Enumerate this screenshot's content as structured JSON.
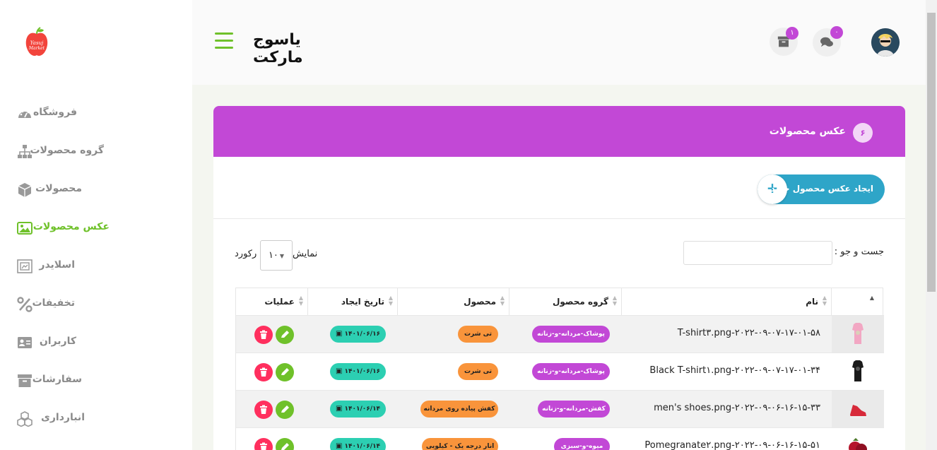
{
  "app": {
    "title": "یاسوج مارکت",
    "logo_text": "Yasuj Market"
  },
  "header": {
    "messages_badge": "۰",
    "archive_badge": "۱"
  },
  "sidebar": {
    "items": [
      {
        "label": "فروشگاه",
        "icon": "dashboard-icon"
      },
      {
        "label": "گروه محصولات",
        "icon": "sitemap-icon"
      },
      {
        "label": "محصولات",
        "icon": "cube-icon"
      },
      {
        "label": "عکس محصولات",
        "icon": "image-icon",
        "active": true
      },
      {
        "label": "اسلایدر",
        "icon": "slider-icon"
      },
      {
        "label": "تخفیفات",
        "icon": "percent-icon"
      },
      {
        "label": "کاربران",
        "icon": "id-card-icon"
      },
      {
        "label": "سفارشات",
        "icon": "archive-icon"
      },
      {
        "label": "انبارداری",
        "icon": "boxes-icon"
      }
    ]
  },
  "card": {
    "number": "۶",
    "title": "عکس محصولات",
    "create_label": "ایجاد عکس محصول جدید",
    "create_icon": "+"
  },
  "controls": {
    "search_label": "جست و جو :",
    "show_label": "نمایش",
    "page_size": "۱۰",
    "records_label": "رکورد"
  },
  "table": {
    "headers": {
      "name": "نام",
      "group": "گروه محصول",
      "product": "محصول",
      "date": "تاریخ ایجاد",
      "ops": "عملیات"
    },
    "rows": [
      {
        "file": "T-shirt۳.png-۲۰۲۲-۰۹-۰۷-۱۷-۰۱-۵۸",
        "group": "پوشاک-مردانه-و-زنانه",
        "product": "تی شرت",
        "date": "۱۴۰۱/۰۶/۱۶"
      },
      {
        "file": "Black T-shirt۱.png-۲۰۲۲-۰۹-۰۷-۱۷-۰۱-۳۴",
        "group": "پوشاک-مردانه-و-زنانه",
        "product": "تی شرت",
        "date": "۱۴۰۱/۰۶/۱۶"
      },
      {
        "file": "men's shoes.png-۲۰۲۲-۰۹-۰۶-۱۶-۱۵-۳۳",
        "group": "کفش-مردانه-و-زنانه",
        "product": "کفش پیاده روی مردانه",
        "date": "۱۴۰۱/۰۶/۱۴"
      },
      {
        "file": "Pomegranate۲.png-۲۰۲۲-۰۹-۰۶-۱۶-۱۵-۵۱",
        "group": "میوه-و-سبزی",
        "product": "انار درجه یک - کیلویی",
        "date": "۱۴۰۱/۰۶/۱۴"
      }
    ]
  },
  "colors": {
    "accent_green": "#6fc12a",
    "header_purple": "#c248d6",
    "button_blue": "#2ea5c8",
    "date_teal": "#2ccfb2",
    "product_orange": "#f9943b",
    "delete_red": "#ff2f5e"
  }
}
